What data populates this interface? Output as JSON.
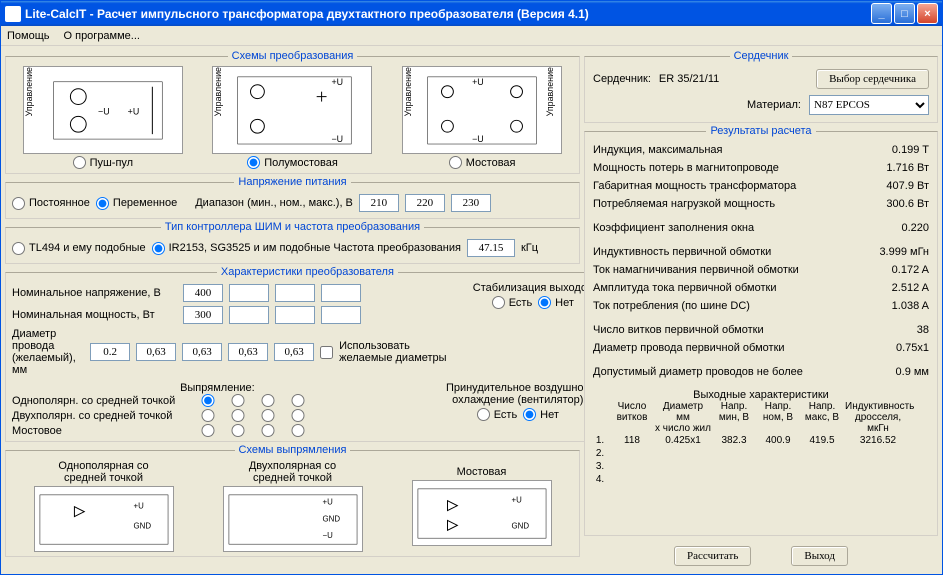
{
  "title": "Lite-CalcIT - Расчет импульсного трансформатора двухтактного преобразователя (Версия 4.1)",
  "menu": {
    "help": "Помощь",
    "about": "О программе..."
  },
  "schemes": {
    "legend": "Схемы  преобразования",
    "pushpull": "Пуш-пул",
    "halfbridge": "Полумостовая",
    "fullbridge": "Мостовая"
  },
  "voltage": {
    "legend": "Напряжение питания",
    "dc": "Постоянное",
    "ac": "Переменное",
    "range": "Диапазон (мин., ном., макс.), В",
    "min": "210",
    "nom": "220",
    "max": "230"
  },
  "controller": {
    "legend": "Тип контроллера ШИМ и частота преобразования",
    "tl494": "TL494 и ему подобные",
    "ir2153": "IR2153, SG3525 и им подобные  Частота преобразования",
    "freq": "47.15",
    "unit": "кГц"
  },
  "char": {
    "legend": "Характеристики преобразователя",
    "nomV": "Номинальное напряжение, В",
    "nomP": "Номинальная мощность, Вт",
    "diam": "Диаметр провода\n(желаемый), мм",
    "v1": "400",
    "p1": "300",
    "d1": "0.2",
    "d2": "0,63",
    "d3": "0,63",
    "d4": "0,63",
    "d5": "0,63",
    "usediam": "Использовать желаемые диаметры",
    "stab": "Стабилизация выходов",
    "yes": "Есть",
    "no": "Нет",
    "rect": "Выпрямление:",
    "unipolar": "Однополярн. со средней точкой",
    "bipolar": "Двухполярн. со средней точкой",
    "bridge": "Мостовое",
    "cool": "Принудительное воздушное\nохлаждение (вентилятор)"
  },
  "rectschemes": {
    "legend": "Схемы выпрямления",
    "uni": "Однополярная со\nсредней точкой",
    "bi": "Двухполярная со\nсредней точкой",
    "bridge": "Мостовая"
  },
  "core": {
    "legend": "Сердечник",
    "label": "Сердечник:",
    "value": "ER 35/21/11",
    "btn": "Выбор сердечника",
    "mat": "Материал:",
    "matval": "N87 EPCOS"
  },
  "res": {
    "legend": "Результаты расчета",
    "rows": [
      {
        "l": "Индукция, максимальная",
        "v": "0.199 T"
      },
      {
        "l": "Мощность потерь в магнитопроводе",
        "v": "1.716 Вт"
      },
      {
        "l": "Габаритная мощность трансформатора",
        "v": "407.9 Вт"
      },
      {
        "l": "Потребляемая нагрузкой мощность",
        "v": "300.6 Вт"
      }
    ],
    "rows2": [
      {
        "l": "Коэффициент заполнения окна",
        "v": "0.220"
      }
    ],
    "rows3": [
      {
        "l": "Индуктивность первичной обмотки",
        "v": "3.999 мГн"
      },
      {
        "l": "Ток намагничивания первичной обмотки",
        "v": "0.172 A"
      },
      {
        "l": "Амплитуда тока первичной обмотки",
        "v": "2.512 A"
      },
      {
        "l": "Ток потребления (по шине DC)",
        "v": "1.038 A"
      }
    ],
    "rows4": [
      {
        "l": "Число витков первичной обмотки",
        "v": "38"
      },
      {
        "l": "Диаметр провода первичной обмотки",
        "v": "0.75x1"
      }
    ],
    "rows5": [
      {
        "l": "Допустимый диаметр проводов не более",
        "v": "0.9 мм"
      }
    ],
    "outhdr": "Выходные характеристики",
    "cols": [
      "",
      "Число\nвитков",
      "Диаметр мм\nx число жил",
      "Напр.\nмин, В",
      "Напр.\nном, В",
      "Напр.\nмакс, В",
      "Индуктивность\nдросселя, мкГн"
    ],
    "outrows": [
      {
        "n": "1.",
        "turns": "118",
        "diam": "0.425x1",
        "vmin": "382.3",
        "vnom": "400.9",
        "vmax": "419.5",
        "ind": "3216.52"
      },
      {
        "n": "2.",
        "turns": "",
        "diam": "",
        "vmin": "",
        "vnom": "",
        "vmax": "",
        "ind": ""
      },
      {
        "n": "3.",
        "turns": "",
        "diam": "",
        "vmin": "",
        "vnom": "",
        "vmax": "",
        "ind": ""
      },
      {
        "n": "4.",
        "turns": "",
        "diam": "",
        "vmin": "",
        "vnom": "",
        "vmax": "",
        "ind": ""
      }
    ]
  },
  "btns": {
    "calc": "Рассчитать",
    "exit": "Выход"
  }
}
